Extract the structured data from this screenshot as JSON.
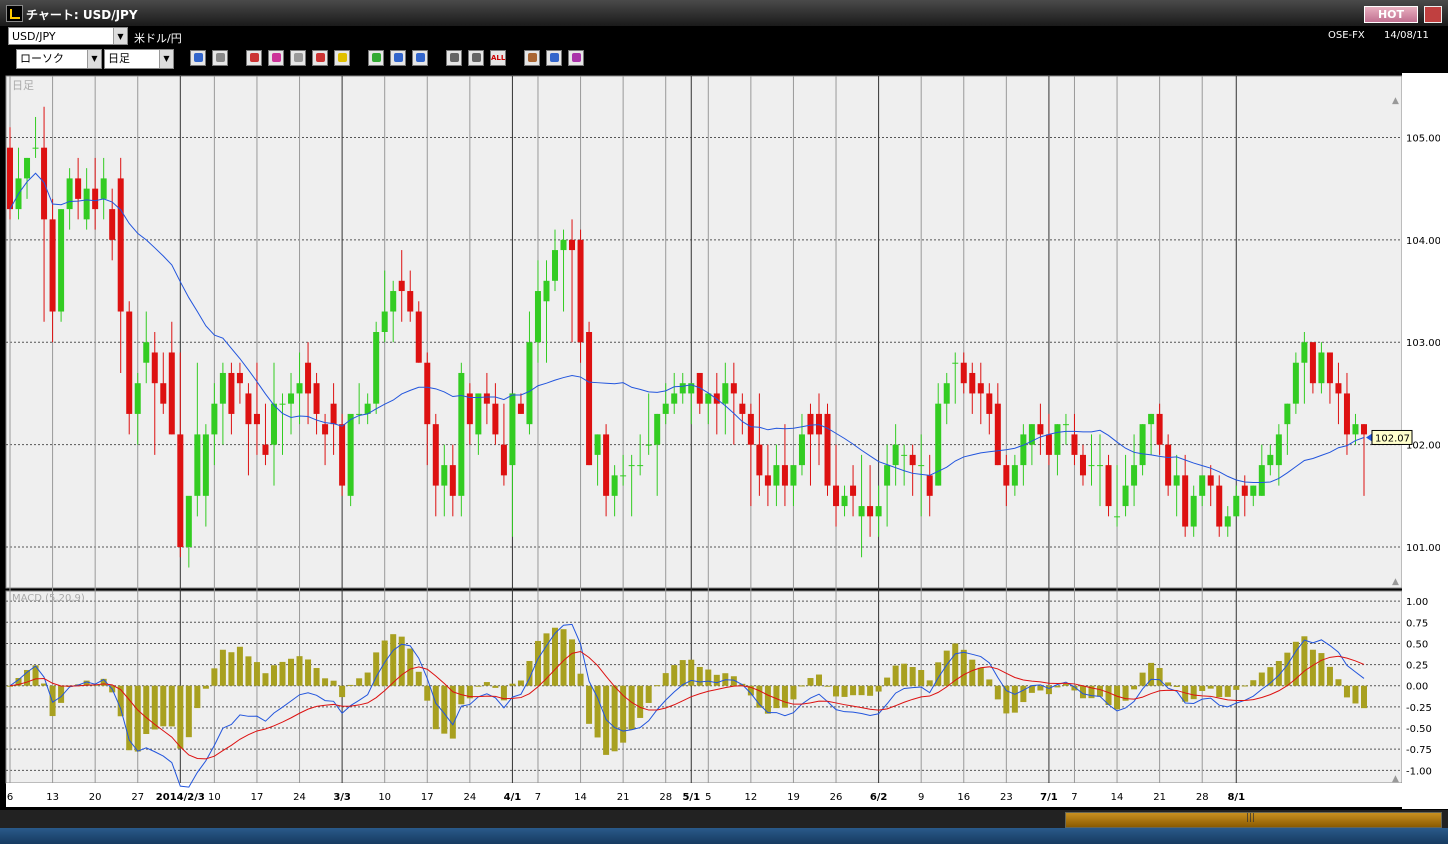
{
  "window": {
    "title": "チャート: USD/JPY",
    "hot_label": "HOT"
  },
  "header": {
    "symbol_select": "USD/JPY",
    "symbol_desc": "米ドル/円",
    "source": "OSE-FX",
    "date": "14/08/11",
    "chart_type_select": "ローソク",
    "period_select": "日足"
  },
  "toolbar_icons": [
    "zoom-icon",
    "crosshair-icon",
    "drag-icon",
    "search-icon",
    "grid-icon",
    "trend-icon",
    "alert-icon",
    "pen-icon",
    "pointer-icon",
    "undo-icon",
    "range-icon",
    "range2-icon",
    "all-icon",
    "settings-icon",
    "tool-icon",
    "color-icon"
  ],
  "toolbar_all_label": "ALL",
  "chart_data": {
    "type": "candlestick",
    "main_panel_label": "日足",
    "price_ticks": [
      "105.00",
      "104.00",
      "103.00",
      "102.00",
      "101.00"
    ],
    "ylim": [
      100.6,
      105.6
    ],
    "last_price_label": "102.07",
    "macd_label": "MACD (5,20,9)",
    "macd_ticks": [
      "1.00",
      "0.75",
      "0.50",
      "0.25",
      "0.00",
      "-0.25",
      "-0.50",
      "-0.75",
      "-1.00"
    ],
    "macd_ylim": [
      -1.15,
      1.12
    ],
    "x_labels": [
      "6",
      "13",
      "20",
      "27",
      "2014/2/3",
      "10",
      "17",
      "24",
      "3/3",
      "10",
      "17",
      "24",
      "4/1",
      "7",
      "14",
      "21",
      "28",
      "5/1",
      "5",
      "12",
      "19",
      "26",
      "6/2",
      "9",
      "16",
      "23",
      "7/1",
      "7",
      "14",
      "21",
      "28",
      "8/1"
    ],
    "candles": [
      [
        104.9,
        105.1,
        104.2,
        104.3
      ],
      [
        104.3,
        104.9,
        104.2,
        104.6
      ],
      [
        104.6,
        104.8,
        104.4,
        104.8
      ],
      [
        104.9,
        105.2,
        104.8,
        104.9
      ],
      [
        104.9,
        105.3,
        103.2,
        104.2
      ],
      [
        104.2,
        104.4,
        103.0,
        103.3
      ],
      [
        103.3,
        104.3,
        103.2,
        104.3
      ],
      [
        104.3,
        104.7,
        104.1,
        104.6
      ],
      [
        104.6,
        104.8,
        104.2,
        104.4
      ],
      [
        104.2,
        104.7,
        104.1,
        104.5
      ],
      [
        104.5,
        104.8,
        104.1,
        104.3
      ],
      [
        104.4,
        104.8,
        104.2,
        104.6
      ],
      [
        104.3,
        104.5,
        103.8,
        104.0
      ],
      [
        104.6,
        104.8,
        102.7,
        103.3
      ],
      [
        103.3,
        103.4,
        102.1,
        102.3
      ],
      [
        102.3,
        102.7,
        102.0,
        102.6
      ],
      [
        102.8,
        103.3,
        102.6,
        103.0
      ],
      [
        102.9,
        103.1,
        101.9,
        102.6
      ],
      [
        102.6,
        102.9,
        102.3,
        102.4
      ],
      [
        102.9,
        103.2,
        102.1,
        102.1
      ],
      [
        102.1,
        102.9,
        100.9,
        101.0
      ],
      [
        101.0,
        101.4,
        100.8,
        101.5
      ],
      [
        101.5,
        102.8,
        101.3,
        102.1
      ],
      [
        101.5,
        102.2,
        101.2,
        102.1
      ],
      [
        102.1,
        102.6,
        101.8,
        102.4
      ],
      [
        102.4,
        102.8,
        102.0,
        102.7
      ],
      [
        102.7,
        102.8,
        102.1,
        102.3
      ],
      [
        102.7,
        102.8,
        102.4,
        102.6
      ],
      [
        102.5,
        102.6,
        101.7,
        102.2
      ],
      [
        102.3,
        102.8,
        101.9,
        102.2
      ],
      [
        102.0,
        102.4,
        101.8,
        101.9
      ],
      [
        102.0,
        102.8,
        101.6,
        102.4
      ],
      [
        102.4,
        102.5,
        101.9,
        102.4
      ],
      [
        102.4,
        102.7,
        102.1,
        102.5
      ],
      [
        102.5,
        102.9,
        102.2,
        102.6
      ],
      [
        102.8,
        103.0,
        102.2,
        102.5
      ],
      [
        102.6,
        102.7,
        102.1,
        102.3
      ],
      [
        102.2,
        102.3,
        101.8,
        102.1
      ],
      [
        102.4,
        102.6,
        101.9,
        102.2
      ],
      [
        102.2,
        102.3,
        101.5,
        101.6
      ],
      [
        101.5,
        102.2,
        101.4,
        102.3
      ],
      [
        102.3,
        102.6,
        102.2,
        102.3
      ],
      [
        102.3,
        102.5,
        102.2,
        102.4
      ],
      [
        102.4,
        103.2,
        102.3,
        103.1
      ],
      [
        103.1,
        103.7,
        103.0,
        103.3
      ],
      [
        103.3,
        103.6,
        103.0,
        103.5
      ],
      [
        103.6,
        103.9,
        103.2,
        103.5
      ],
      [
        103.5,
        103.7,
        103.2,
        103.3
      ],
      [
        103.3,
        103.4,
        102.8,
        102.8
      ],
      [
        102.8,
        102.9,
        101.8,
        102.2
      ],
      [
        102.2,
        102.3,
        101.3,
        101.6
      ],
      [
        101.6,
        102.0,
        101.3,
        101.8
      ],
      [
        101.8,
        102.0,
        101.3,
        101.5
      ],
      [
        101.5,
        102.8,
        101.3,
        102.7
      ],
      [
        102.5,
        102.6,
        102.0,
        102.2
      ],
      [
        102.1,
        102.5,
        101.9,
        102.5
      ],
      [
        102.5,
        102.7,
        102.2,
        102.4
      ],
      [
        102.4,
        102.6,
        102.0,
        102.1
      ],
      [
        102.0,
        102.4,
        101.6,
        101.7
      ],
      [
        101.8,
        102.3,
        101.1,
        102.5
      ],
      [
        102.4,
        102.5,
        102.3,
        102.3
      ],
      [
        102.2,
        103.3,
        102.1,
        103.0
      ],
      [
        103.0,
        103.8,
        102.8,
        103.5
      ],
      [
        103.4,
        103.8,
        102.8,
        103.6
      ],
      [
        103.6,
        104.1,
        103.5,
        103.9
      ],
      [
        103.9,
        104.1,
        103.3,
        104.0
      ],
      [
        104.0,
        104.2,
        103.0,
        103.9
      ],
      [
        104.0,
        104.1,
        102.8,
        103.0
      ],
      [
        103.1,
        103.2,
        101.8,
        101.8
      ],
      [
        101.9,
        102.1,
        101.6,
        102.1
      ],
      [
        102.1,
        102.2,
        101.3,
        101.5
      ],
      [
        101.5,
        101.8,
        101.3,
        101.7
      ],
      [
        101.7,
        101.9,
        101.6,
        101.7
      ],
      [
        101.8,
        101.9,
        101.3,
        101.8
      ],
      [
        101.8,
        102.1,
        101.7,
        101.8
      ],
      [
        102.0,
        102.5,
        101.9,
        102.0
      ],
      [
        102.0,
        102.3,
        101.5,
        102.3
      ],
      [
        102.3,
        102.6,
        102.2,
        102.4
      ],
      [
        102.4,
        102.7,
        102.3,
        102.5
      ],
      [
        102.5,
        102.7,
        102.4,
        102.6
      ],
      [
        102.5,
        102.6,
        102.2,
        102.6
      ],
      [
        102.7,
        102.6,
        102.3,
        102.4
      ],
      [
        102.4,
        102.5,
        102.2,
        102.5
      ],
      [
        102.5,
        102.7,
        102.1,
        102.4
      ],
      [
        102.4,
        102.8,
        102.1,
        102.6
      ],
      [
        102.6,
        102.8,
        102.0,
        102.5
      ],
      [
        102.4,
        102.5,
        102.1,
        102.3
      ],
      [
        102.3,
        102.4,
        101.4,
        102.0
      ],
      [
        102.0,
        102.5,
        101.5,
        101.7
      ],
      [
        101.7,
        102.0,
        101.4,
        101.6
      ],
      [
        101.6,
        102.0,
        101.4,
        101.8
      ],
      [
        101.8,
        102.2,
        101.4,
        101.6
      ],
      [
        101.6,
        101.8,
        101.4,
        101.8
      ],
      [
        101.8,
        102.3,
        101.7,
        102.1
      ],
      [
        102.3,
        102.4,
        101.6,
        102.1
      ],
      [
        102.3,
        102.5,
        101.8,
        102.1
      ],
      [
        102.3,
        102.4,
        101.5,
        101.6
      ],
      [
        101.6,
        102.0,
        101.2,
        101.4
      ],
      [
        101.4,
        101.6,
        101.3,
        101.5
      ],
      [
        101.6,
        101.8,
        101.3,
        101.5
      ],
      [
        101.3,
        101.9,
        100.9,
        101.4
      ],
      [
        101.4,
        101.8,
        101.1,
        101.3
      ],
      [
        101.3,
        101.6,
        101.1,
        101.4
      ],
      [
        101.6,
        102.0,
        101.2,
        101.8
      ],
      [
        101.8,
        102.2,
        101.6,
        102.0
      ],
      [
        101.9,
        102.0,
        101.6,
        101.9
      ],
      [
        101.9,
        102.0,
        101.5,
        101.8
      ],
      [
        101.8,
        102.1,
        101.3,
        101.8
      ],
      [
        101.7,
        101.9,
        101.3,
        101.5
      ],
      [
        101.6,
        102.6,
        101.6,
        102.4
      ],
      [
        102.4,
        102.7,
        102.2,
        102.6
      ],
      [
        102.8,
        102.9,
        102.4,
        102.8
      ],
      [
        102.8,
        102.9,
        102.5,
        102.6
      ],
      [
        102.7,
        102.8,
        102.3,
        102.5
      ],
      [
        102.6,
        102.8,
        102.2,
        102.5
      ],
      [
        102.5,
        102.6,
        102.1,
        102.3
      ],
      [
        102.4,
        102.6,
        101.8,
        101.8
      ],
      [
        101.8,
        101.9,
        101.4,
        101.6
      ],
      [
        101.6,
        101.9,
        101.5,
        101.8
      ],
      [
        101.8,
        102.2,
        101.6,
        102.1
      ],
      [
        102.0,
        102.2,
        101.8,
        102.2
      ],
      [
        102.2,
        102.4,
        101.9,
        102.1
      ],
      [
        102.1,
        102.3,
        101.8,
        101.9
      ],
      [
        101.9,
        102.2,
        101.7,
        102.2
      ],
      [
        102.2,
        102.3,
        102.0,
        102.2
      ],
      [
        102.1,
        102.3,
        101.8,
        101.9
      ],
      [
        101.9,
        102.0,
        101.6,
        101.7
      ],
      [
        101.8,
        102.1,
        101.6,
        101.8
      ],
      [
        101.8,
        102.1,
        101.4,
        101.8
      ],
      [
        101.8,
        101.9,
        101.3,
        101.4
      ],
      [
        101.3,
        101.8,
        101.2,
        101.3
      ],
      [
        101.4,
        101.9,
        101.3,
        101.6
      ],
      [
        101.6,
        102.1,
        101.4,
        101.8
      ],
      [
        101.8,
        102.2,
        101.7,
        102.2
      ],
      [
        102.2,
        102.3,
        101.9,
        102.3
      ],
      [
        102.3,
        102.4,
        101.9,
        102.0
      ],
      [
        102.0,
        102.1,
        101.5,
        101.6
      ],
      [
        101.6,
        101.9,
        101.3,
        101.7
      ],
      [
        101.7,
        101.9,
        101.1,
        101.2
      ],
      [
        101.2,
        101.6,
        101.1,
        101.5
      ],
      [
        101.5,
        101.7,
        101.4,
        101.7
      ],
      [
        101.7,
        101.8,
        101.4,
        101.6
      ],
      [
        101.6,
        101.7,
        101.1,
        101.2
      ],
      [
        101.2,
        101.4,
        101.1,
        101.3
      ],
      [
        101.3,
        101.6,
        101.3,
        101.5
      ],
      [
        101.6,
        101.7,
        101.3,
        101.5
      ],
      [
        101.5,
        101.6,
        101.4,
        101.6
      ],
      [
        101.5,
        102.0,
        101.5,
        101.8
      ],
      [
        101.8,
        102.0,
        101.7,
        101.9
      ],
      [
        101.8,
        102.2,
        101.6,
        102.1
      ],
      [
        102.2,
        102.4,
        101.9,
        102.4
      ],
      [
        102.4,
        102.9,
        102.3,
        102.8
      ],
      [
        102.8,
        103.1,
        102.4,
        103.0
      ],
      [
        103.0,
        103.0,
        102.5,
        102.6
      ],
      [
        102.6,
        103.0,
        102.5,
        102.9
      ],
      [
        102.9,
        102.9,
        102.4,
        102.6
      ],
      [
        102.6,
        102.8,
        102.2,
        102.5
      ],
      [
        102.5,
        102.7,
        101.9,
        102.1
      ],
      [
        102.1,
        102.3,
        102.0,
        102.2
      ],
      [
        102.2,
        102.2,
        101.5,
        102.1
      ]
    ]
  }
}
